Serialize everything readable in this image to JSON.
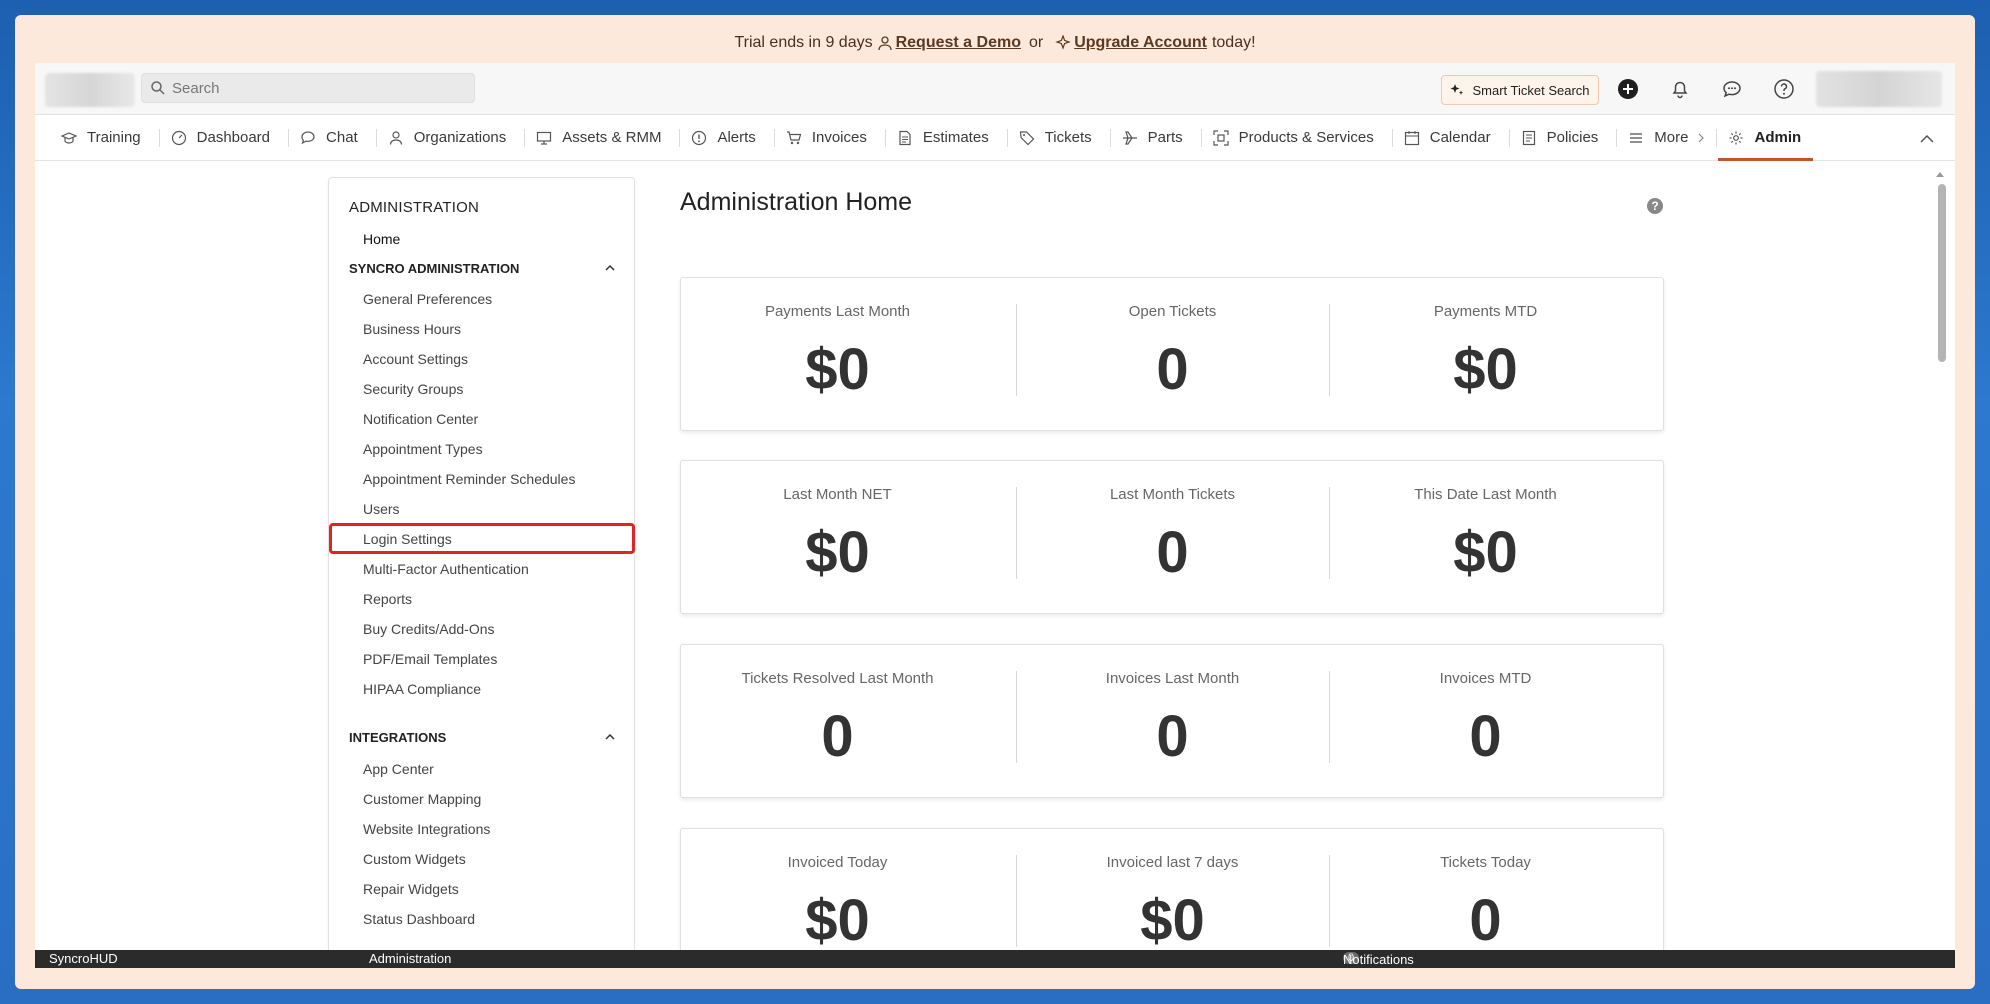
{
  "banner": {
    "prefix": "Trial ends in 9 days",
    "demo_link": "Request a Demo",
    "or": "or",
    "upgrade_link": "Upgrade Account",
    "suffix": "today!"
  },
  "topbar": {
    "search_placeholder": "Search",
    "smart_search_label": "Smart Ticket Search",
    "icons": [
      "add-icon",
      "bell-icon",
      "chat-bubble-icon",
      "help-icon"
    ]
  },
  "nav": {
    "items": [
      {
        "label": "Training",
        "icon": "graduation-cap-icon"
      },
      {
        "label": "Dashboard",
        "icon": "gauge-icon"
      },
      {
        "label": "Chat",
        "icon": "chat-icon"
      },
      {
        "label": "Organizations",
        "icon": "person-icon"
      },
      {
        "label": "Assets & RMM",
        "icon": "monitor-icon"
      },
      {
        "label": "Alerts",
        "icon": "alert-icon"
      },
      {
        "label": "Invoices",
        "icon": "cart-icon"
      },
      {
        "label": "Estimates",
        "icon": "document-icon"
      },
      {
        "label": "Tickets",
        "icon": "tag-icon"
      },
      {
        "label": "Parts",
        "icon": "plane-icon"
      },
      {
        "label": "Products & Services",
        "icon": "scan-icon"
      },
      {
        "label": "Calendar",
        "icon": "calendar-icon"
      },
      {
        "label": "Policies",
        "icon": "policy-icon"
      },
      {
        "label": "More",
        "icon": "menu-icon"
      },
      {
        "label": "Admin",
        "icon": "gear-icon",
        "active": true
      }
    ]
  },
  "sidebar": {
    "title": "ADMINISTRATION",
    "home": "Home",
    "sections": [
      {
        "title": "SYNCRO ADMINISTRATION",
        "links": [
          "General Preferences",
          "Business Hours",
          "Account Settings",
          "Security Groups",
          "Notification Center",
          "Appointment Types",
          "Appointment Reminder Schedules",
          "Users",
          "Login Settings",
          "Multi-Factor Authentication",
          "Reports",
          "Buy Credits/Add-Ons",
          "PDF/Email Templates",
          "HIPAA Compliance"
        ]
      },
      {
        "title": "INTEGRATIONS",
        "links": [
          "App Center",
          "Customer Mapping",
          "Website Integrations",
          "Custom Widgets",
          "Repair Widgets",
          "Status Dashboard"
        ]
      }
    ],
    "highlighted": "Login Settings"
  },
  "main": {
    "title": "Administration Home",
    "cards": [
      [
        {
          "label": "Payments Last Month",
          "value": "$0"
        },
        {
          "label": "Open Tickets",
          "value": "0"
        },
        {
          "label": "Payments MTD",
          "value": "$0"
        }
      ],
      [
        {
          "label": "Last Month NET",
          "value": "$0"
        },
        {
          "label": "Last Month Tickets",
          "value": "0"
        },
        {
          "label": "This Date Last Month",
          "value": "$0"
        }
      ],
      [
        {
          "label": "Tickets Resolved Last Month",
          "value": "0"
        },
        {
          "label": "Invoices Last Month",
          "value": "0"
        },
        {
          "label": "Invoices MTD",
          "value": "0"
        }
      ],
      [
        {
          "label": "Invoiced Today",
          "value": "$0"
        },
        {
          "label": "Invoiced last 7 days",
          "value": "$0"
        },
        {
          "label": "Tickets Today",
          "value": "0"
        }
      ]
    ]
  },
  "statusbar": {
    "app": "SyncroHUD",
    "section": "Administration",
    "notif_count": "0",
    "notif_label": "Notifications"
  },
  "colors": {
    "banner_bg": "#fde8dc",
    "accent": "#c4522a",
    "highlight": "#e02424",
    "statusbar_bg": "#2b2b2b"
  }
}
